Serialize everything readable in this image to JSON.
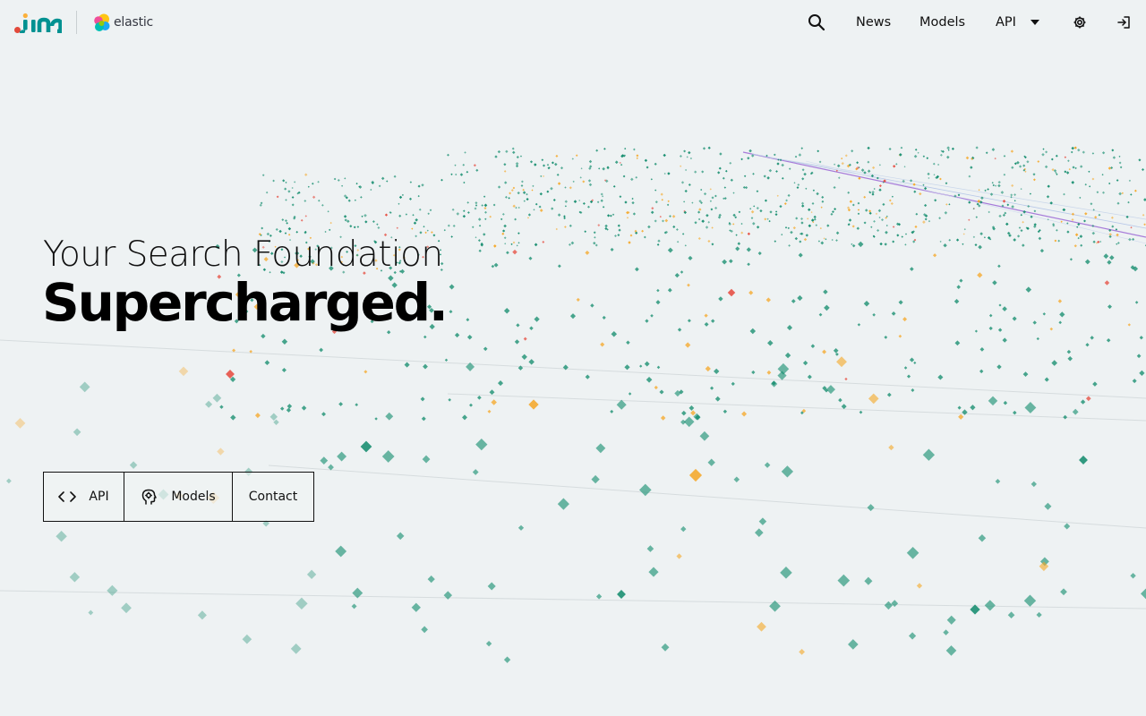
{
  "header": {
    "brand_elastic": "elastic",
    "nav": {
      "news": "News",
      "models": "Models",
      "api": "API"
    },
    "icons": [
      "search-icon",
      "caret-down-icon",
      "gear-icon",
      "login-icon"
    ]
  },
  "hero": {
    "line1": "Your Search Foundation",
    "line2": "Supercharged."
  },
  "cta": {
    "api": "API",
    "models": "Models",
    "contact": "Contact"
  },
  "colors": {
    "background": "#eef2f3",
    "jina_teal": "#009191",
    "jina_red": "#e24a3b",
    "particle_green": "#0e8a6a",
    "particle_orange": "#f5a623",
    "particle_red": "#e5483b",
    "beam_purple": "#a77bd9"
  }
}
